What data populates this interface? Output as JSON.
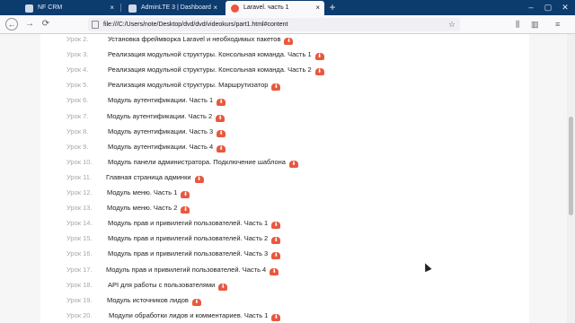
{
  "browser": {
    "tabs": [
      {
        "title": "NF CRM",
        "icon": "nf-logo-icon",
        "active": false
      },
      {
        "title": "AdminLTE 3 | Dashboard",
        "icon": "adminlte-icon",
        "active": false
      },
      {
        "title": "Laravel. часть 1",
        "icon": "laravel-icon",
        "active": true
      }
    ],
    "close_glyph": "×",
    "new_tab_glyph": "+",
    "url": "file:///C:/Users/note/Desktop/dvd/dvd/videokurs/part1.html#content",
    "window": {
      "minimize": "–",
      "maximize": "▢",
      "close": "✕"
    },
    "nav": {
      "back": "←",
      "forward": "→",
      "reload": "⟳",
      "star": "☆",
      "library": "⫼",
      "sidebar": "▥",
      "menu": "≡"
    }
  },
  "lessons": [
    {
      "num": "Урок 2.",
      "title": "Установка фреймворка Laravel и необходимых пакетов"
    },
    {
      "num": "Урок 3.",
      "title": "Реализация модульной структуры. Консольная команда. Часть 1"
    },
    {
      "num": "Урок 4.",
      "title": "Реализация модульной структуры. Консольная команда. Часть 2"
    },
    {
      "num": "Урок 5.",
      "title": "Реализация модульной структуры. Маршрутизатор"
    },
    {
      "num": "Урок 6.",
      "title": "Модуль аутентификации. Часть 1"
    },
    {
      "num": "Урок 7.",
      "title": "Модуль аутентификации. Часть 2"
    },
    {
      "num": "Урок 8.",
      "title": "Модуль аутентификации. Часть 3"
    },
    {
      "num": "Урок 9.",
      "title": "Модуль аутентификации. Часть 4"
    },
    {
      "num": "Урок 10.",
      "title": "Модуль панели администратора. Подключение шаблона"
    },
    {
      "num": "Урок 11.",
      "title": "Главная страница админки"
    },
    {
      "num": "Урок 12.",
      "title": "Модуль меню. Часть 1"
    },
    {
      "num": "Урок 13.",
      "title": "Модуль меню. Часть 2"
    },
    {
      "num": "Урок 14.",
      "title": "Модуль прав и привилегий пользователей. Часть 1"
    },
    {
      "num": "Урок 15.",
      "title": "Модуль прав и привилегий пользователей. Часть 2"
    },
    {
      "num": "Урок 16.",
      "title": "Модуль прав и привилегий пользователей. Часть 3"
    },
    {
      "num": "Урок 17.",
      "title": "Модуль прав и привилегий пользователей. Часть 4"
    },
    {
      "num": "Урок 18.",
      "title": "API для работы с пользователями"
    },
    {
      "num": "Урок 19.",
      "title": "Модуль источников лидов"
    },
    {
      "num": "Урок 20.",
      "title": "Модули обработки лидов и комментариев. Часть 1"
    }
  ],
  "download_icon": "cloud-download-icon",
  "download_glyph": "⬇",
  "colors": {
    "titlebar": "#0c3b6e",
    "download": "#e9583e",
    "lesson_num": "#a8a8a8"
  }
}
